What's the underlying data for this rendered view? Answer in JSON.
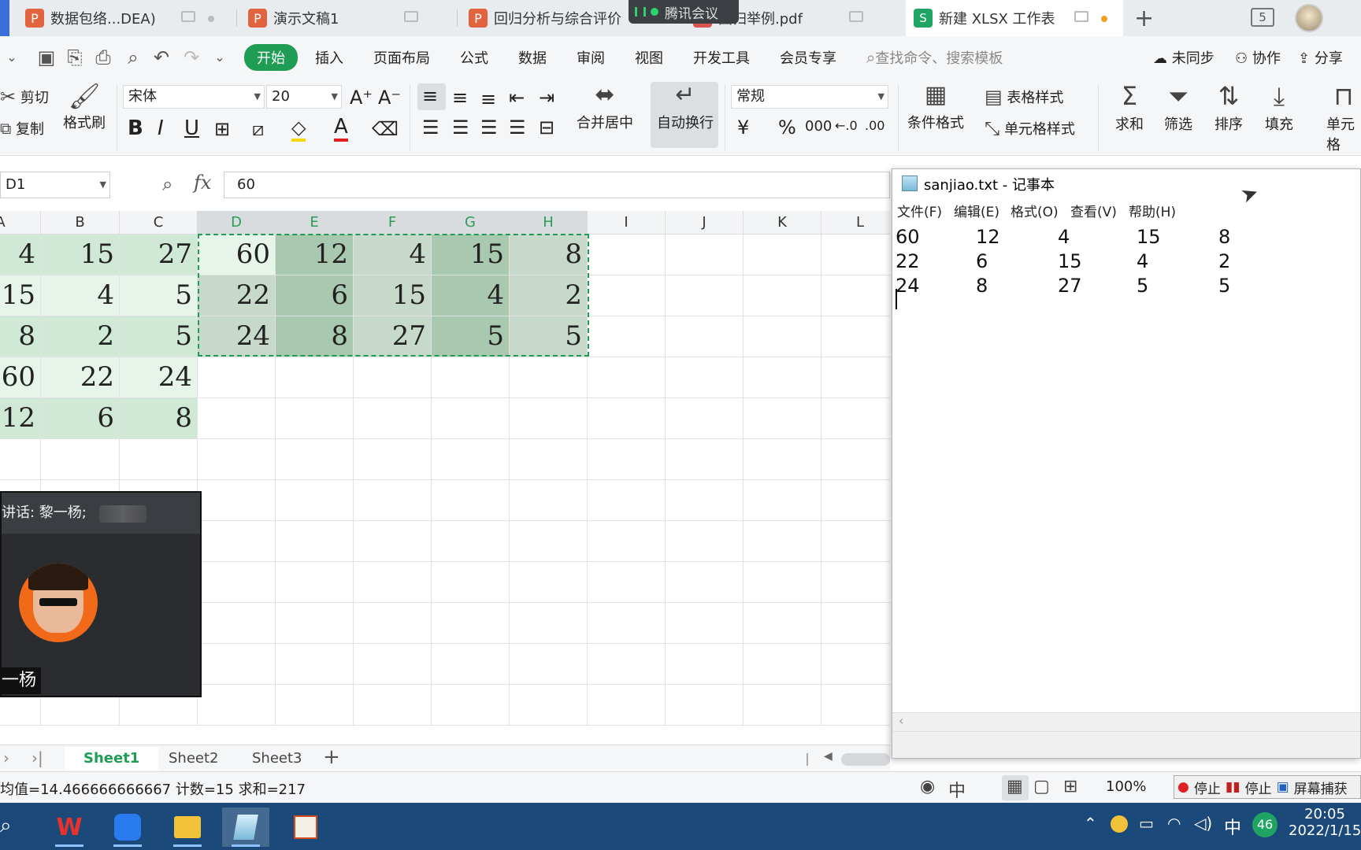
{
  "tabs": [
    {
      "label": "数据包络...DEA)",
      "type": "ppt"
    },
    {
      "label": "演示文稿1",
      "type": "ppt"
    },
    {
      "label": "回归分析与综合评价",
      "type": "ppt"
    },
    {
      "label": "回归举例.pdf",
      "type": "pdf"
    },
    {
      "label": "新建 XLSX 工作表",
      "type": "xls",
      "active": true
    }
  ],
  "meeting_banner": "腾讯会议",
  "tab_count": "5",
  "menu": {
    "items": [
      "开始",
      "插入",
      "页面布局",
      "公式",
      "数据",
      "审阅",
      "视图",
      "开发工具",
      "会员专享"
    ],
    "search_placeholder": "查找命令、搜索模板",
    "sync": "未同步",
    "collab": "协作",
    "share": "分享"
  },
  "ribbon": {
    "cut": "剪切",
    "copy": "复制",
    "format_painter": "格式刷",
    "font_name": "宋体",
    "font_size": "20",
    "merge_center": "合并居中",
    "wrap_text": "自动换行",
    "number_format": "常规",
    "cond_format": "条件格式",
    "table_style": "表格样式",
    "cell_style": "单元格样式",
    "sum": "求和",
    "filter": "筛选",
    "sort": "排序",
    "fill": "填充",
    "cell": "单元格"
  },
  "formula_bar": {
    "name_box": "D1",
    "fx": "fx",
    "value": "60"
  },
  "columns": [
    "A",
    "B",
    "C",
    "D",
    "E",
    "F",
    "G",
    "H",
    "I",
    "J",
    "K",
    "L"
  ],
  "grid_left": [
    [
      "4",
      "15",
      "27"
    ],
    [
      "15",
      "4",
      "5"
    ],
    [
      "8",
      "2",
      "5"
    ],
    [
      "60",
      "22",
      "24"
    ],
    [
      "12",
      "6",
      "8"
    ]
  ],
  "grid_selected": [
    [
      "60",
      "12",
      "4",
      "15",
      "8"
    ],
    [
      "22",
      "6",
      "15",
      "4",
      "2"
    ],
    [
      "24",
      "8",
      "27",
      "5",
      "5"
    ]
  ],
  "sheets": [
    "Sheet1",
    "Sheet2",
    "Sheet3"
  ],
  "status": {
    "stats": "均值=14.466666666667  计数=15  求和=217",
    "zoom": "100%",
    "rec_stop1": "停止",
    "rec_stop2": "停止",
    "rec_capture": "屏幕捕获"
  },
  "notepad": {
    "title": "sanjiao.txt - 记事本",
    "menu": [
      "文件(F)",
      "编辑(E)",
      "格式(O)",
      "查看(V)",
      "帮助(H)"
    ],
    "rows": [
      [
        "60",
        "12",
        "4",
        "15",
        "8"
      ],
      [
        "22",
        "6",
        "15",
        "4",
        "2"
      ],
      [
        "24",
        "8",
        "27",
        "5",
        "5"
      ]
    ]
  },
  "meeting": {
    "speaking": "讲话: 黎一杨;",
    "name": "一杨"
  },
  "taskbar": {
    "ime": "中",
    "badge": "46",
    "time": "20:05",
    "date": "2022/1/15"
  },
  "colors": {
    "accent": "#1f9d55",
    "cell_light": "#e6f4ea",
    "cell_mid": "#cfe9d6",
    "sel_dark": "#a9c8b0",
    "sel_light": "#c7d9cb",
    "taskbar": "#1b4a7a"
  }
}
